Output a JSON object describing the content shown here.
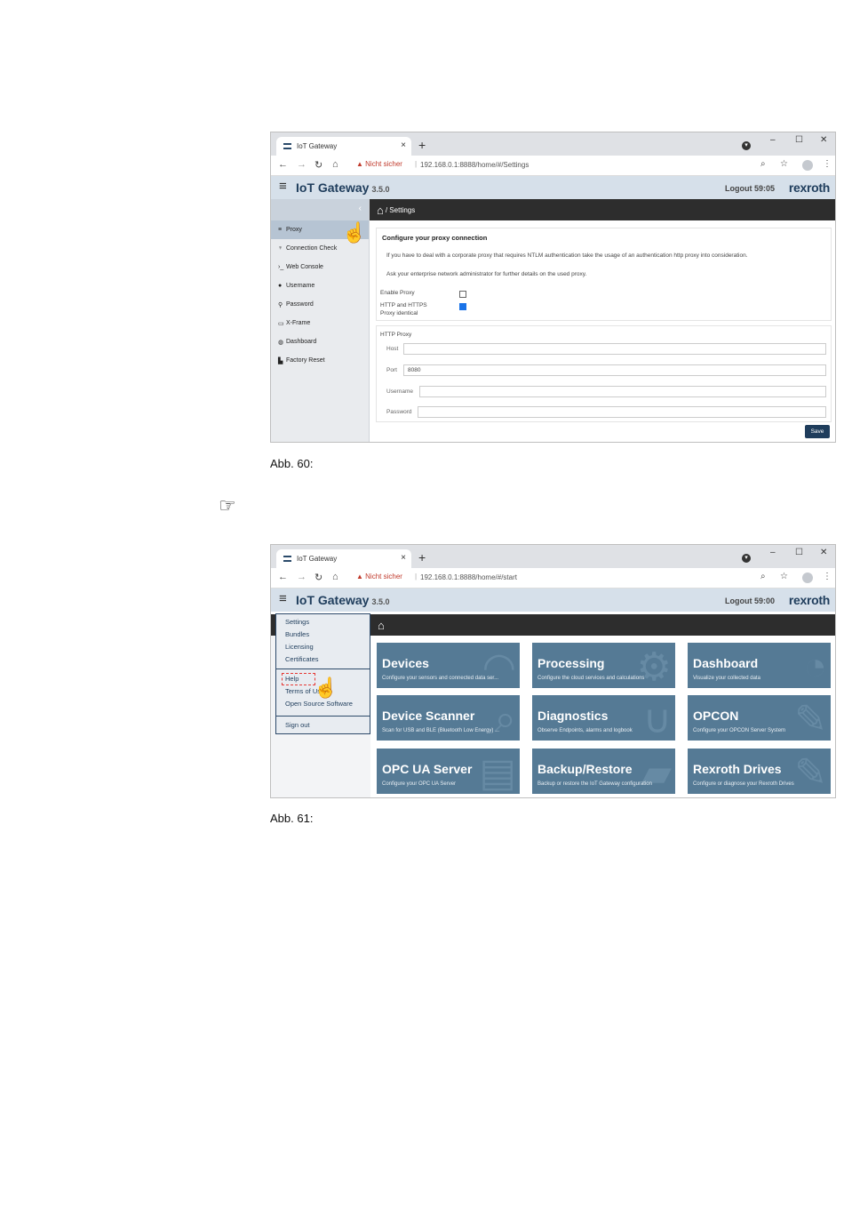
{
  "shot1": {
    "tab_title": "IoT Gateway",
    "tab_close": "×",
    "new_tab": "+",
    "win_min": "–",
    "win_max": "☐",
    "win_close": "✕",
    "security_warning": "Nicht sicher",
    "url": "192.168.0.1:8888/home/#/Settings",
    "app_title": "IoT Gateway",
    "version": "3.5.0",
    "logout": "Logout 59:05",
    "brand": "rexroth",
    "breadcrumb": "/ Settings",
    "sidebar_items": [
      {
        "icon": "≡",
        "label": "Proxy"
      },
      {
        "icon": "♆",
        "label": "Connection Check"
      },
      {
        "icon": "›_",
        "label": "Web Console"
      },
      {
        "icon": "●",
        "label": "Username"
      },
      {
        "icon": "⚲",
        "label": "Password"
      },
      {
        "icon": "▭",
        "label": "X-Frame"
      },
      {
        "icon": "◍",
        "label": "Dashboard"
      },
      {
        "icon": "▙",
        "label": "Factory Reset"
      }
    ],
    "panel_title": "Configure your proxy connection",
    "panel_text_1": "If you have to deal with a corporate proxy that requires NTLM authentication take the usage of an authentication http proxy into consideration.",
    "panel_text_2": "Ask your enterprise network administrator for further details on the used proxy.",
    "enable_proxy_label": "Enable Proxy",
    "identical_label_1": "HTTP and HTTPS",
    "identical_label_2": "Proxy identical",
    "http_proxy_heading": "HTTP Proxy",
    "host_label": "Host",
    "port_label": "Port",
    "port_value": "8080",
    "username_label": "Username",
    "password_label": "Password",
    "save_label": "Save"
  },
  "caption1": "Abb. 60:",
  "note_icon": "☞",
  "shot2": {
    "tab_title": "IoT Gateway",
    "tab_close": "×",
    "new_tab": "+",
    "win_min": "–",
    "win_max": "☐",
    "win_close": "✕",
    "security_warning": "Nicht sicher",
    "url": "192.168.0.1:8888/home/#/start",
    "app_title": "IoT Gateway",
    "version": "3.5.0",
    "logout": "Logout 59:00",
    "brand": "rexroth",
    "menu_group_1": [
      "Settings",
      "Bundles",
      "Licensing",
      "Certificates"
    ],
    "menu_group_2": [
      "Help",
      "Terms of Use",
      "Open Source Software"
    ],
    "menu_group_3": [
      "Sign out"
    ],
    "tiles": [
      {
        "title": "Devices",
        "desc": "Configure your sensors and connected data ser...",
        "icon": "◠"
      },
      {
        "title": "Processing",
        "desc": "Configure the cloud services and calculations",
        "icon": "⚙"
      },
      {
        "title": "Dashboard",
        "desc": "Visualize your collected data",
        "icon": "◔"
      },
      {
        "title": "Device Scanner",
        "desc": "Scan for USB and BLE (Bluetooth Low Energy) ...",
        "icon": "⌕"
      },
      {
        "title": "Diagnostics",
        "desc": "Observe Endpoints, alarms and logbook",
        "icon": "∪"
      },
      {
        "title": "OPCON",
        "desc": "Configure your OPCON Server System",
        "icon": "✎"
      },
      {
        "title": "OPC UA Server",
        "desc": "Configure your OPC UA Server",
        "icon": "▤"
      },
      {
        "title": "Backup/Restore",
        "desc": "Backup or restore the IoT Gateway configuration",
        "icon": "▰"
      },
      {
        "title": "Rexroth Drives",
        "desc": "Configure or diagnose your Rexroth Drives",
        "icon": "✎"
      }
    ]
  },
  "caption2": "Abb. 61:"
}
